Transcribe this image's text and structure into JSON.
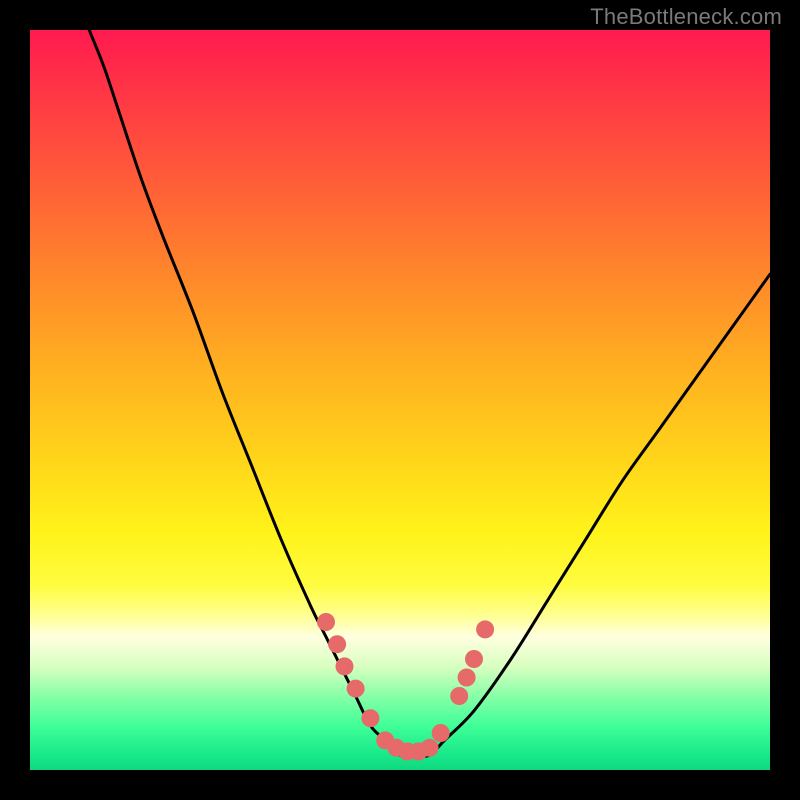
{
  "attribution": "TheBottleneck.com",
  "colors": {
    "frame": "#000000",
    "curve_stroke": "#000000",
    "marker_fill": "#e66a6a",
    "gradient_top": "#ff1a4f",
    "gradient_bottom": "#10d880"
  },
  "chart_data": {
    "type": "line",
    "title": "",
    "xlabel": "",
    "ylabel": "",
    "xlim": [
      0,
      100
    ],
    "ylim": [
      0,
      100
    ],
    "series": [
      {
        "name": "bottleneck-curve",
        "x": [
          8,
          10,
          12,
          15,
          18,
          22,
          26,
          30,
          34,
          38,
          40,
          42,
          44,
          46,
          48,
          50,
          52,
          54,
          56,
          60,
          65,
          70,
          75,
          80,
          85,
          90,
          95,
          100
        ],
        "y": [
          100,
          95,
          89,
          80,
          72,
          62,
          51,
          41,
          31,
          22,
          18,
          14,
          10,
          6,
          4,
          2,
          2,
          2,
          4,
          8,
          15,
          23,
          31,
          39,
          46,
          53,
          60,
          67
        ]
      }
    ],
    "markers": {
      "name": "highlighted-points",
      "x": [
        40,
        41.5,
        42.5,
        44,
        46,
        48,
        49.5,
        51,
        52.5,
        54,
        55.5,
        58,
        59,
        60,
        61.5
      ],
      "y": [
        20,
        17,
        14,
        11,
        7,
        4,
        3,
        2.5,
        2.5,
        3,
        5,
        10,
        12.5,
        15,
        19
      ]
    }
  }
}
